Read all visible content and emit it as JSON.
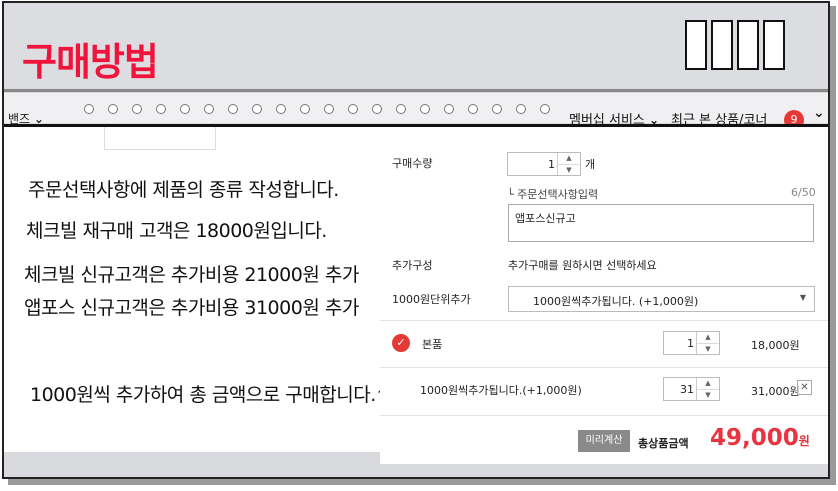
{
  "header": {
    "title": "구매방법"
  },
  "nav": {
    "left_text": "밴즈",
    "items": [
      {
        "label": "멤버십 서비스"
      },
      {
        "label": "최근 본 상품/코너"
      }
    ],
    "recent_count": "9"
  },
  "notes": [
    "주문선택사항에 제품의 종류 작성합니다.",
    "체크빌 재구매 고객은 18000원입니다.",
    "체크빌 신규고객은 추가비용 21000원 추가",
    "앱포스 신규고객은 추가비용 31000원 추가",
    "1000원씩 추가하여  총 금액으로 구매합니다.^^"
  ],
  "order": {
    "quantity_label": "구매수량",
    "quantity_value": "1",
    "quantity_unit": "개",
    "option_input_label": "└ 주문선택사항입력",
    "option_input_counter": "6/50",
    "option_input_value": "앱포스신규고",
    "extra_label": "추가구성",
    "extra_hint": "추가구매를 원하시면 선택하세요",
    "unit_add_label": "1000원단위추가",
    "unit_add_selected": "1000원씩추가됩니다. (+1,000원)",
    "lines": [
      {
        "name": "본품",
        "qty": "1",
        "price": "18,000원"
      },
      {
        "name": "1000원씩추가됩니다.(+1,000원)",
        "qty": "31",
        "price": "31,000원"
      }
    ],
    "calc_button": "미리계산",
    "total_label": "총상품금액",
    "total_value": "49,000",
    "total_unit": "원"
  }
}
